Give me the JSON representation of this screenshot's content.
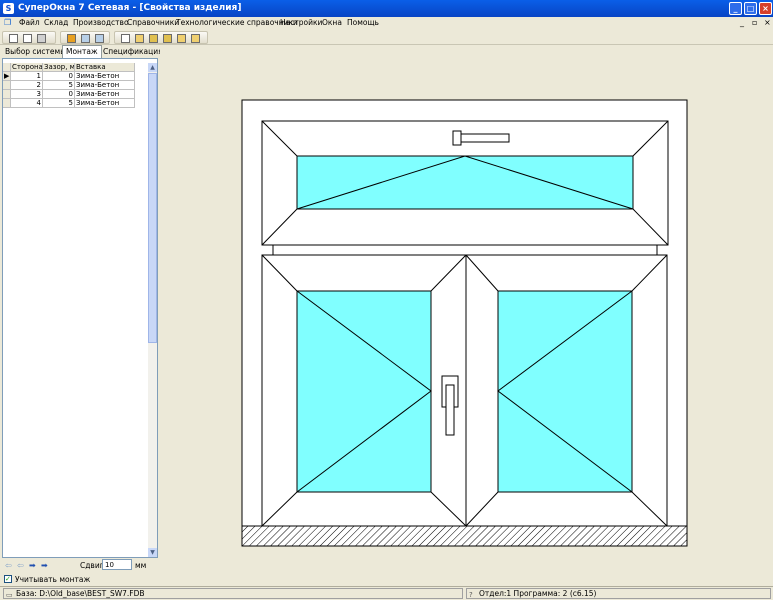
{
  "titlebar": {
    "title": "СуперОкна 7 Сетевая - [Свойства изделия]",
    "minimize": "_",
    "maximize": "□",
    "close": "×"
  },
  "menu": [
    "Файл",
    "Склад",
    "Производство",
    "Справочники",
    "Технологические справочники",
    "Настройки",
    "Окна",
    "Помощь"
  ],
  "mdi": {
    "minimize": "_",
    "restore": "▫",
    "close": "×"
  },
  "tabs": {
    "system": "Выбор системы",
    "montage": "Монтаж",
    "spec": "Спецификация"
  },
  "table": {
    "headers": [
      "Сторона",
      "Зазор, мм",
      "Вставка"
    ],
    "rows": [
      [
        "1",
        "0",
        "Зима-Бетон"
      ],
      [
        "2",
        "5",
        "Зима-Бетон"
      ],
      [
        "3",
        "0",
        "Зима-Бетон"
      ],
      [
        "4",
        "5",
        "Зима-Бетон"
      ]
    ]
  },
  "controls": {
    "shift_label": "Сдвиг",
    "shift_value": "10",
    "shift_unit": "мм",
    "montage_check_label": "Учитывать монтаж",
    "montage_checked": "✓"
  },
  "status": {
    "base": "База: D:\\Old_base\\BEST_SW7.FDB",
    "info": "Отдел:1 Программа: 2 (c6.15)"
  },
  "colors": {
    "glass": "#80FFFF",
    "frame": "#FFFFFF",
    "line": "#000000"
  }
}
